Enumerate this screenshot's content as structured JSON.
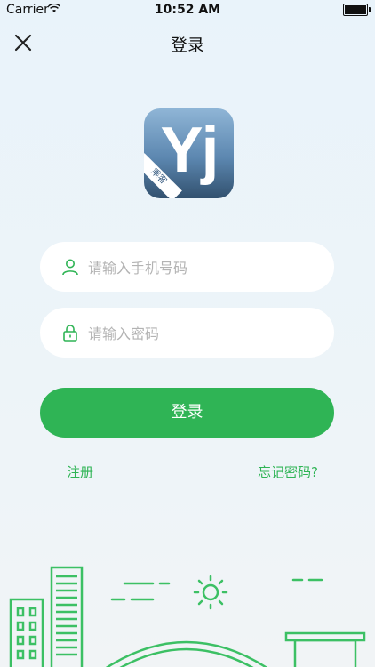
{
  "status_bar": {
    "carrier": "Carrier",
    "time": "10:52 AM"
  },
  "nav": {
    "title": "登录",
    "close_icon": "close-icon"
  },
  "logo": {
    "mark": "Yj",
    "ribbon": "乘客"
  },
  "form": {
    "phone_placeholder": "请输入手机号码",
    "password_placeholder": "请输入密码",
    "login_label": "登录"
  },
  "links": {
    "register": "注册",
    "forgot_password": "忘记密码?"
  },
  "colors": {
    "accent": "#2fb455",
    "background": "#e9f3fa"
  }
}
